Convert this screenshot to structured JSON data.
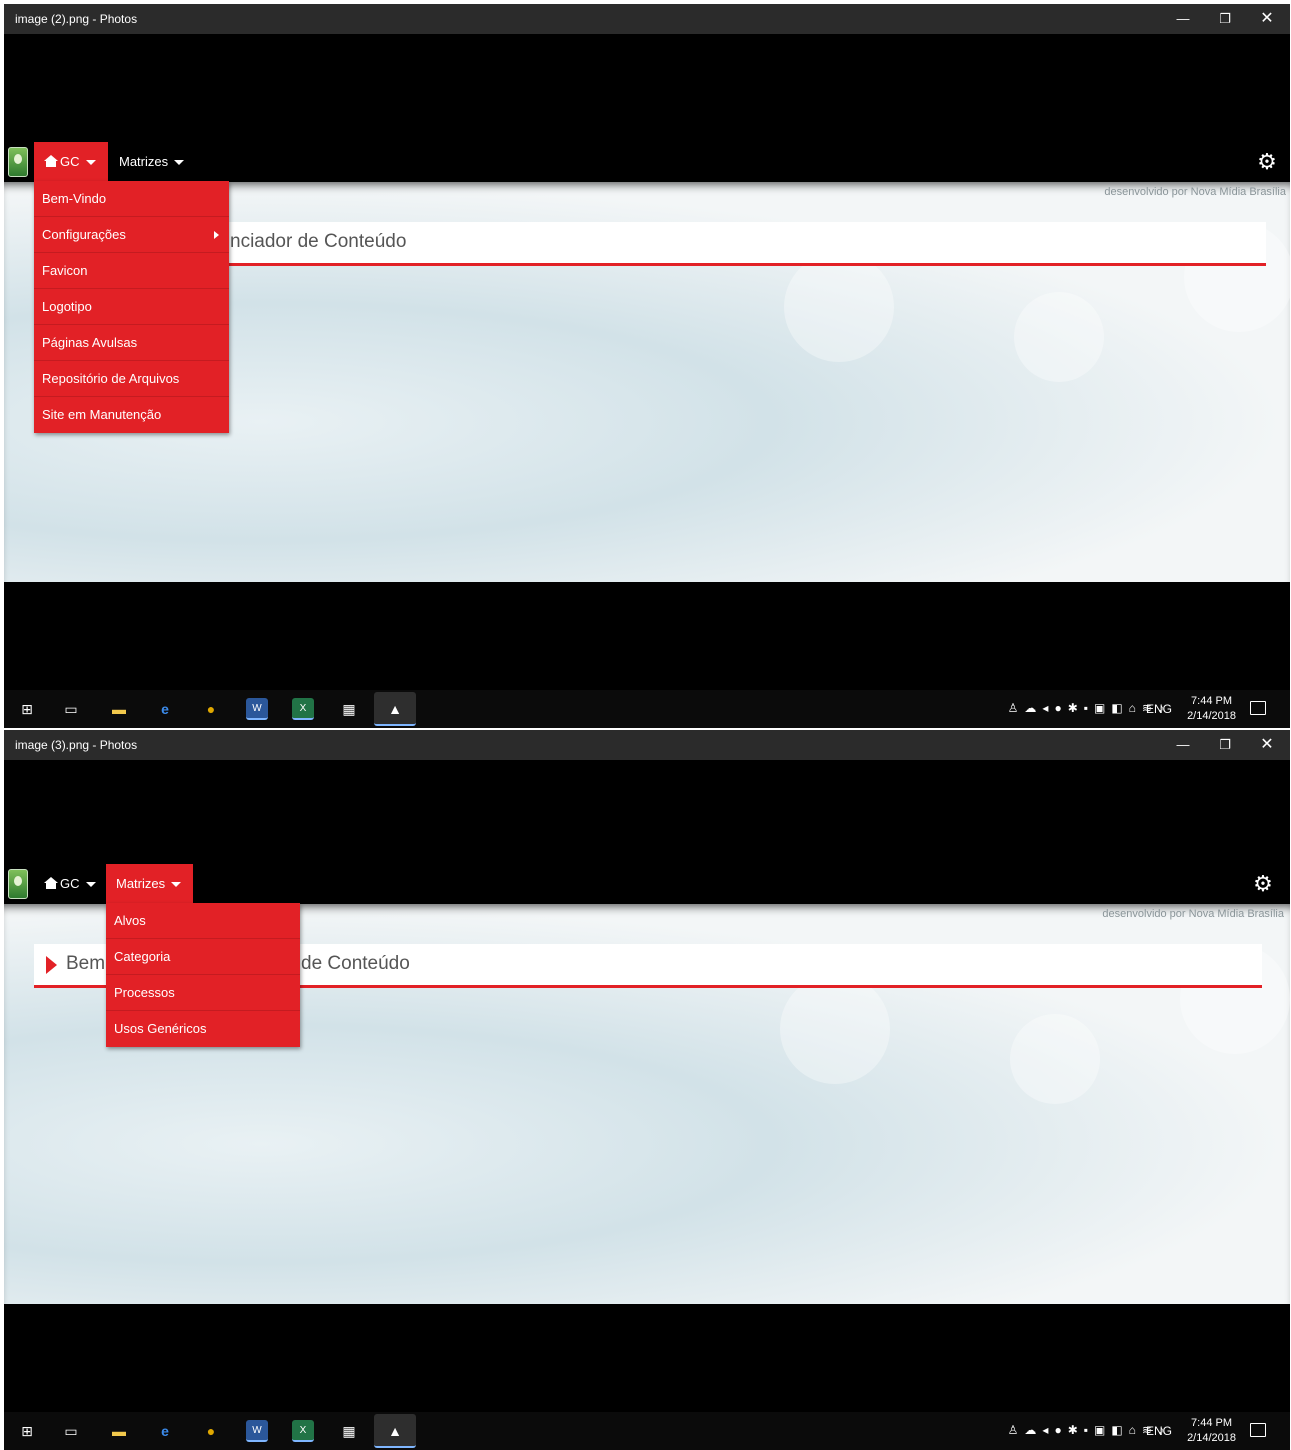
{
  "screens": [
    {
      "window_title": "image (2).png - Photos",
      "nav": {
        "gc_label": "GC",
        "matrizes_label": "Matrizes"
      },
      "credit": "desenvolvido por Nova Mídia Brasília",
      "heading_text": "nciador de Conteúdo",
      "dropdown_items": [
        "Bem-Vindo",
        "Configurações",
        "Favicon",
        "Logotipo",
        "Páginas Avulsas",
        "Repositório de Arquivos",
        "Site em Manutenção"
      ],
      "taskbar": {
        "lang": "ENG",
        "time": "7:44 PM",
        "date": "2/14/2018"
      }
    },
    {
      "window_title": "image (3).png - Photos",
      "nav": {
        "gc_label": "GC",
        "matrizes_label": "Matrizes"
      },
      "credit": "desenvolvido por Nova Mídia Brasília",
      "heading_left": "Bem",
      "heading_text": "de Conteúdo",
      "dropdown_items": [
        "Alvos",
        "Categoria",
        "Processos",
        "Usos Genéricos"
      ],
      "taskbar": {
        "lang": "ENG",
        "time": "7:44 PM",
        "date": "2/14/2018"
      }
    }
  ],
  "window_buttons": {
    "minimize": "—",
    "maximize": "❐",
    "close": "✕"
  },
  "colors": {
    "accent": "#e22126",
    "titlebar": "#2b2b2b",
    "taskbar": "#0b0b0b"
  },
  "icons": [
    "windows-start-icon",
    "task-view-icon",
    "file-explorer-icon",
    "edge-icon",
    "chrome-icon",
    "word-icon",
    "excel-icon",
    "calculator-icon",
    "photos-icon",
    "gear-icon",
    "home-icon"
  ]
}
